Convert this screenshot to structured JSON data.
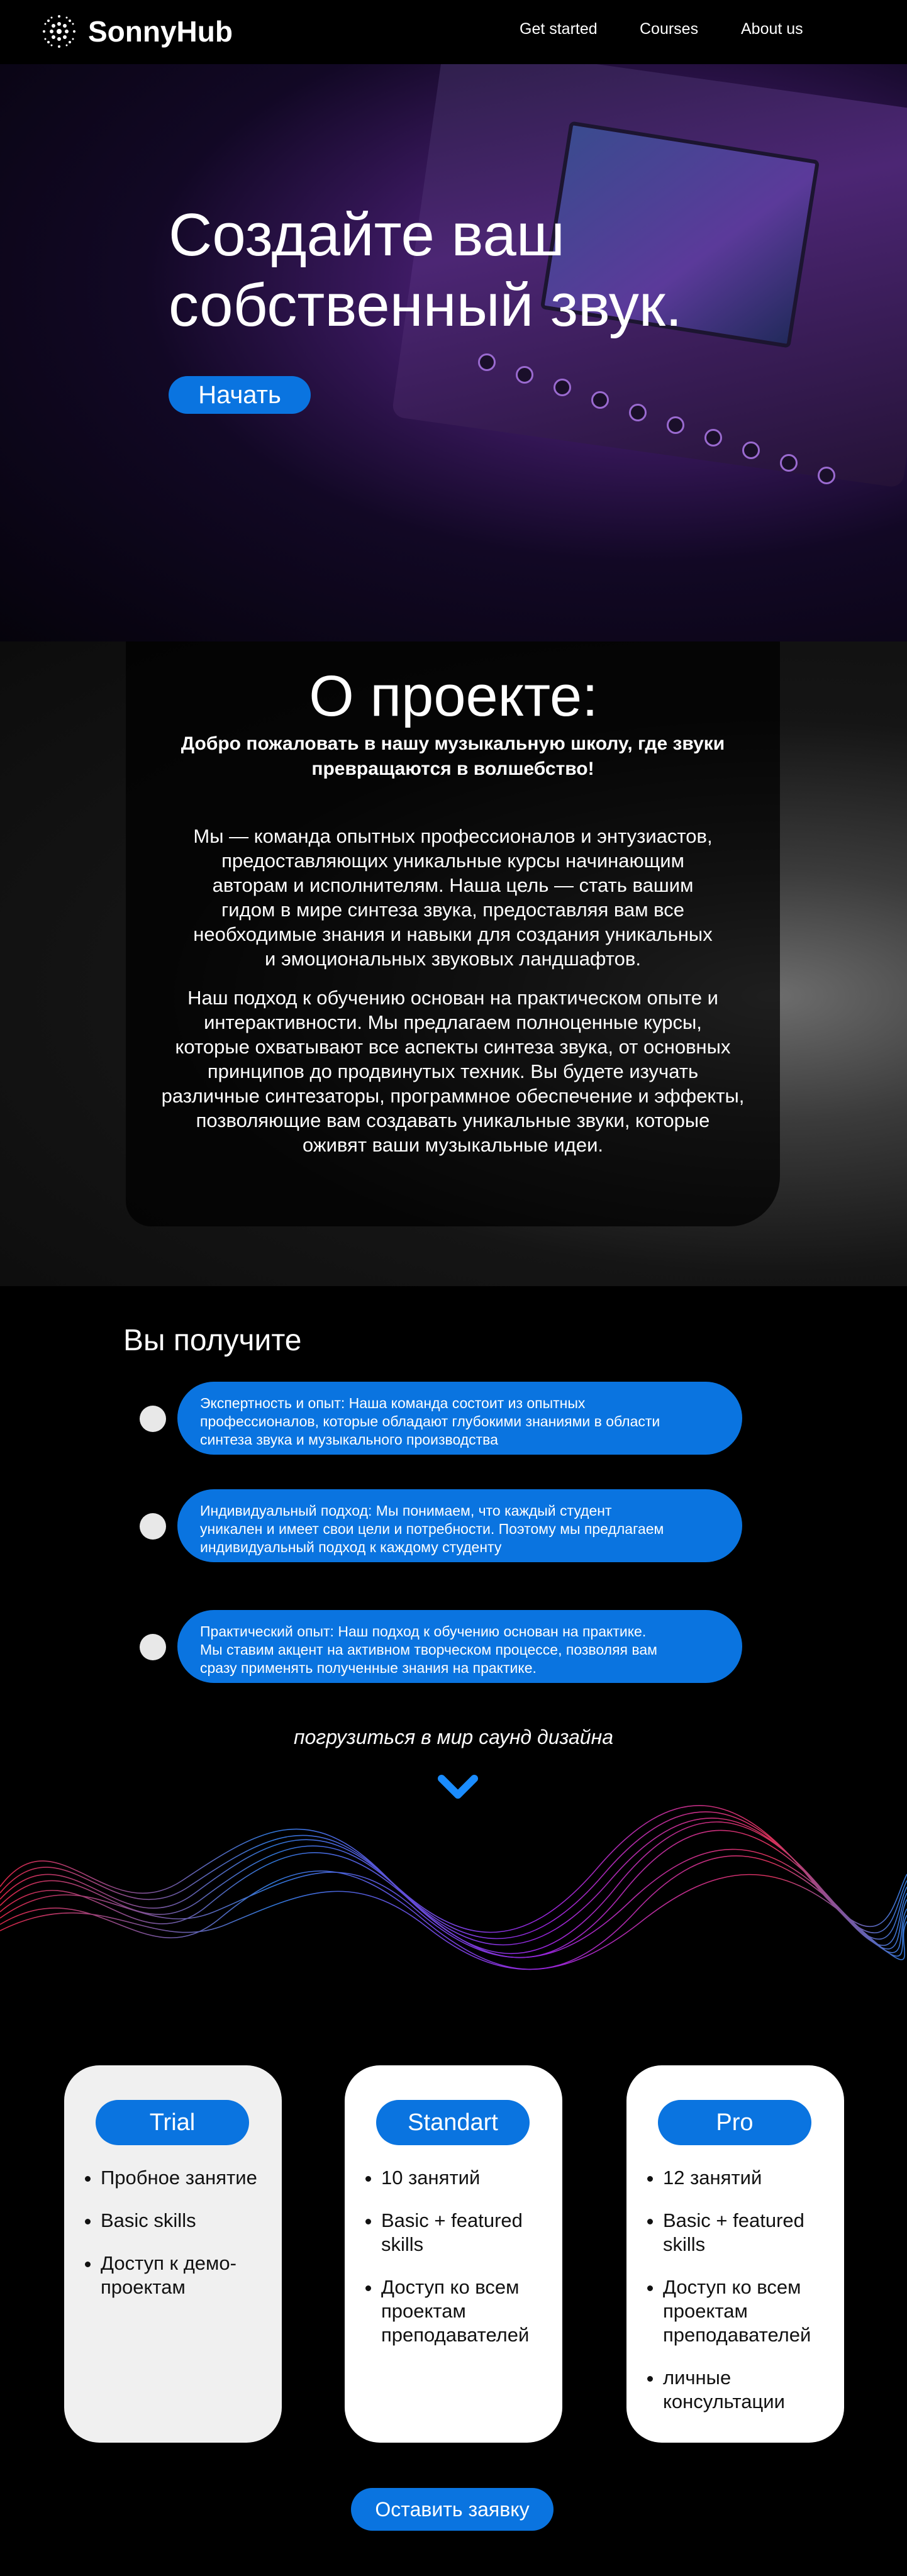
{
  "header": {
    "logo_text": "SonnyHub",
    "nav": [
      {
        "label": "Get started"
      },
      {
        "label": "Courses"
      },
      {
        "label": "About us"
      }
    ]
  },
  "hero": {
    "title_line1": "Создайте ваш",
    "title_line2": "собственный звук.",
    "button_label": "Начать"
  },
  "about": {
    "title": "О проекте:",
    "subtitle_line1": "Добро пожаловать в нашу музыкальную школу, где звуки",
    "subtitle_line2": "превращаются в волшебство!",
    "paragraph1": [
      "Мы — команда опытных профессионалов и энтузиастов,",
      "предоставляющих уникальные курсы начинающим",
      "авторам и исполнителям. Наша цель — стать вашим",
      "гидом в мире синтеза звука, предоставляя вам все",
      "необходимые знания и навыки для создания уникальных",
      "и эмоциональных звуковых ландшафтов."
    ],
    "paragraph2": [
      "Наш подход к обучению основан на практическом опыте и",
      "интерактивности. Мы предлагаем полноценные курсы,",
      "которые охватывают все аспекты синтеза звука, от основных",
      "принципов до продвинутых техник. Вы будете изучать",
      "различные синтезаторы, программное обеспечение и эффекты,",
      "позволяющие вам создавать уникальные звуки, которые",
      "оживят ваши музыкальные идеи."
    ]
  },
  "features": {
    "title": "Вы получите",
    "items": [
      {
        "lines": [
          "Экспертность и опыт: Наша команда состоит из опытных",
          "профессионалов, которые обладают глубокими знаниями в области",
          "синтеза звука и музыкального производства"
        ]
      },
      {
        "lines": [
          "Индивидуальный подход: Мы понимаем, что каждый студент",
          "уникален и имеет свои цели и потребности. Поэтому мы предлагаем",
          "индивидуальный подход к каждому студенту"
        ]
      },
      {
        "lines": [
          "Практический опыт: Наш подход к обучению основан на практике.",
          "Мы ставим акцент на активном творческом процессе, позволяя вам",
          "сразу применять полученные знания на практике."
        ]
      }
    ]
  },
  "cta": {
    "text": "погрузиться в мир саунд дизайна",
    "chevron_icon": "chevron-down-icon"
  },
  "pricing": {
    "plans": [
      {
        "name": "Trial",
        "features": [
          "Пробное занятие",
          "Basic skills",
          "Доступ к демо-проектам"
        ]
      },
      {
        "name": "Standart",
        "features": [
          "10 занятий",
          "Basic + featured skills",
          "Доступ ко всем проектам преподавателей"
        ]
      },
      {
        "name": "Pro",
        "features": [
          "12 занятий",
          "Basic + featured skills",
          "Доступ ко всем проектам преподавателей",
          "личные консультации"
        ]
      }
    ],
    "apply_button": "Оставить заявку"
  },
  "colors": {
    "accent": "#0a74e0",
    "background": "#000000",
    "card_light": "#f0f0f0",
    "card_white": "#ffffff"
  }
}
